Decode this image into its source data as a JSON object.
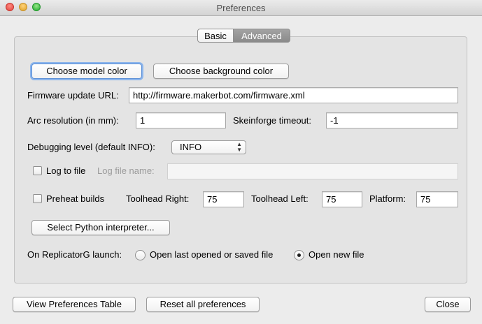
{
  "window": {
    "title": "Preferences"
  },
  "tabs": [
    {
      "label": "Basic",
      "selected": false
    },
    {
      "label": "Advanced",
      "selected": true
    }
  ],
  "advanced": {
    "choose_model_color": "Choose model color",
    "choose_background_color": "Choose background color",
    "firmware_url_label": "Firmware update URL:",
    "firmware_url_value": "http://firmware.makerbot.com/firmware.xml",
    "arc_resolution_label": "Arc resolution (in mm):",
    "arc_resolution_value": "1",
    "skeinforge_timeout_label": "Skeinforge timeout:",
    "skeinforge_timeout_value": "-1",
    "debugging_level_label": "Debugging level (default INFO):",
    "debugging_level_value": "INFO",
    "log_to_file_label": "Log to file",
    "log_to_file_checked": false,
    "log_file_name_label": "Log file name:",
    "log_file_name_value": "",
    "preheat_label": "Preheat builds",
    "preheat_checked": false,
    "toolhead_right_label": "Toolhead Right:",
    "toolhead_right_value": "75",
    "toolhead_left_label": "Toolhead Left:",
    "toolhead_left_value": "75",
    "platform_label": "Platform:",
    "platform_value": "75",
    "python_button": "Select Python interpreter...",
    "launch_label": "On ReplicatorG launch:",
    "launch_option_last": "Open last opened or saved file",
    "launch_option_new": "Open new file",
    "launch_selected": "Open new file"
  },
  "footer": {
    "view_table": "View Preferences Table",
    "reset": "Reset all preferences",
    "close": "Close"
  }
}
